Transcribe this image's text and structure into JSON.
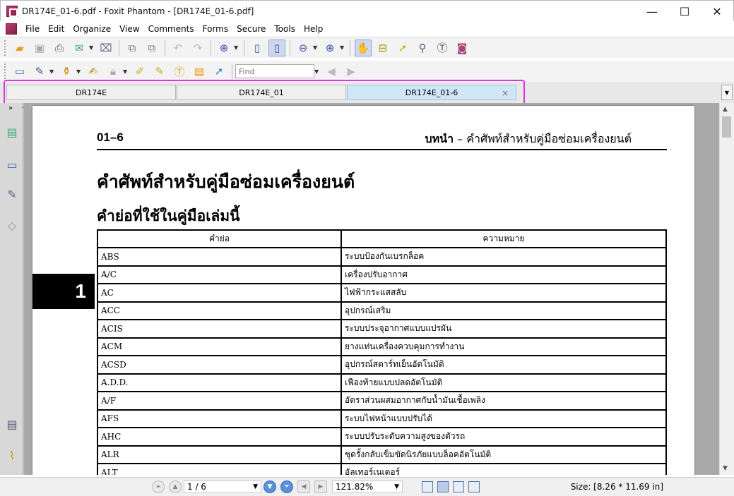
{
  "window": {
    "title": "DR174E_01-6.pdf - Foxit Phantom - [DR174E_01-6.pdf]",
    "minimize_glyph": "—",
    "maximize_glyph": "☐",
    "close_glyph": "✕"
  },
  "menu": {
    "items": [
      "File",
      "Edit",
      "Organize",
      "View",
      "Comments",
      "Forms",
      "Secure",
      "Tools",
      "Help"
    ]
  },
  "toolbar": {
    "find_placeholder": "Find"
  },
  "tabs": [
    {
      "label": "DR174E",
      "active": false
    },
    {
      "label": "DR174E_01",
      "active": false
    },
    {
      "label": "DR174E_01-6",
      "active": true
    }
  ],
  "tab_close_glyph": "×",
  "page": {
    "header_number": "01–6",
    "header_title_bold": "บทนำ",
    "header_title_rest": " – คำศัพท์สำหรับคู่มือซ่อมเครื่องยนต์",
    "heading1": "คำศัพท์สำหรับคู่มือซ่อมเครื่องยนต์",
    "heading2": "คำย่อที่ใช้ในคู่มือเล่มนี้",
    "chapter_tab": "1",
    "table": {
      "headers": [
        "คำย่อ",
        "ความหมาย"
      ],
      "rows": [
        [
          "ABS",
          "ระบบป้องกันเบรกล็อค"
        ],
        [
          "A/C",
          "เครื่องปรับอากาศ"
        ],
        [
          "AC",
          "ไฟฟ้ากระแสสลับ"
        ],
        [
          "ACC",
          "อุปกรณ์เสริม"
        ],
        [
          "ACIS",
          "ระบบประจุอากาศแบบแปรผัน"
        ],
        [
          "ACM",
          "ยางแท่นเครื่องควบคุมการทำงาน"
        ],
        [
          "ACSD",
          "อุปกรณ์สตาร์ทเย็นอัตโนมัติ"
        ],
        [
          "A.D.D.",
          "เฟืองท้ายแบบปลดอัตโนมัติ"
        ],
        [
          "A/F",
          "อัตราส่วนผสมอากาศกับน้ำมันเชื้อเพลิง"
        ],
        [
          "AFS",
          "ระบบไฟหน้าแบบปรับได้"
        ],
        [
          "AHC",
          "ระบบปรับระดับความสูงของตัวรถ"
        ],
        [
          "ALR",
          "ชุดรั้งกลับเข็มขัดนิรภัยแบบล็อคอัตโนมัติ"
        ],
        [
          "ALT",
          "อัลเทอร์เนเตอร์"
        ]
      ]
    }
  },
  "status": {
    "page_indicator": "1 / 6",
    "zoom": "121.82%",
    "size": "Size: [8.26 * 11.69 in]"
  },
  "icons": {
    "left_panel": [
      "bookmarks-icon",
      "pages-icon",
      "layers-icon",
      "attachments-sign-icon",
      "comments-icon",
      "attachment-clip-icon"
    ]
  }
}
